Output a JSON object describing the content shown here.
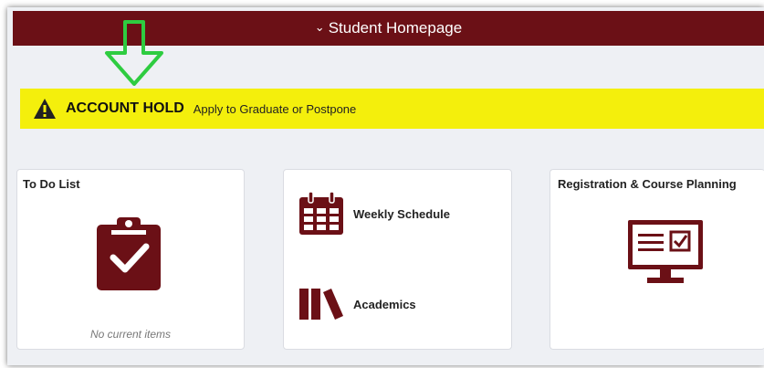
{
  "header": {
    "title": "Student Homepage",
    "chevron_icon": "chevron-down-icon"
  },
  "alert": {
    "title": "ACCOUNT HOLD",
    "message": "Apply to Graduate or Postpone",
    "icon": "warning-icon"
  },
  "tiles": {
    "todo": {
      "title": "To Do List",
      "empty_text": "No current items",
      "icon": "clipboard-check-icon"
    },
    "links": [
      {
        "label": "Weekly Schedule",
        "icon": "calendar-icon"
      },
      {
        "label": "Academics",
        "icon": "books-icon"
      }
    ],
    "registration": {
      "title": "Registration & Course Planning",
      "icon": "monitor-form-icon"
    }
  },
  "colors": {
    "brand": "#6b1016",
    "alert": "#f4ef0c",
    "annotation_arrow": "#2ecc40"
  }
}
